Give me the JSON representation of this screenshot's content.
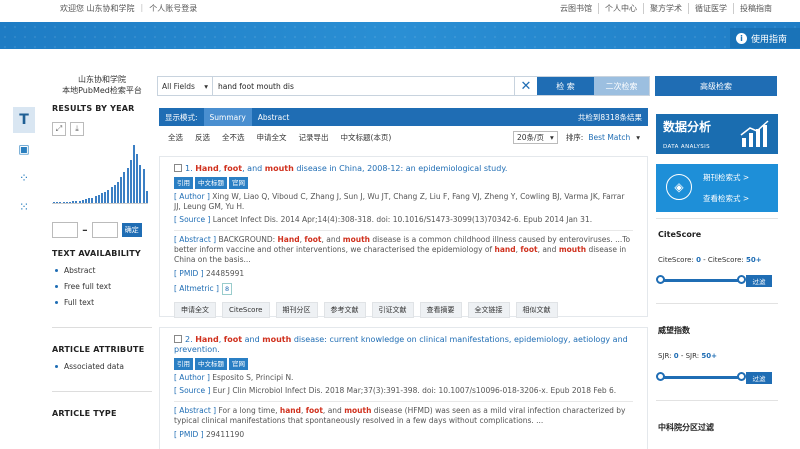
{
  "topbar": {
    "welcome": "欢迎您 山东协和学院",
    "personal_login": "个人账号登录",
    "links": [
      "云图书馆",
      "个人中心",
      "聚方学术",
      "循证医学",
      "投稿指南"
    ]
  },
  "guide_button": "使用指南",
  "org": {
    "line1": "山东协和学院",
    "line2": "本地PubMed检索平台"
  },
  "left": {
    "results_by_year": "RESULTS BY YEAR",
    "year_confirm": "确定",
    "year_sep": "-",
    "text_availability": "TEXT AVAILABILITY",
    "text_filters": [
      "Abstract",
      "Free full text",
      "Full text"
    ],
    "article_attribute": "ARTICLE ATTRIBUTE",
    "attribute_filters": [
      "Associated data"
    ],
    "article_type": "ARTICLE TYPE",
    "histogram": [
      1,
      1,
      1,
      2,
      2,
      2,
      3,
      3,
      4,
      5,
      6,
      8,
      9,
      11,
      13,
      16,
      18,
      22,
      26,
      30,
      35,
      42,
      50,
      58,
      70,
      95,
      80,
      62,
      55,
      20
    ]
  },
  "search": {
    "field": "All Fields",
    "query": "hand foot mouth dis",
    "search_btn": "检 索",
    "second_btn": "二次检索",
    "advanced_btn": "高级检索"
  },
  "display": {
    "label": "显示模式:",
    "tabs": [
      "Summary",
      "Abstract"
    ],
    "total": "共检到8318条结果"
  },
  "actions": {
    "items": [
      "全选",
      "反选",
      "全不选",
      "申请全文",
      "记录导出",
      "中文标题(本页)"
    ],
    "per_page": "20条/页",
    "sort_label": "排序:",
    "sort_value": "Best Match"
  },
  "results": [
    {
      "num": "1.",
      "title_parts": [
        [
          "hl",
          "Hand"
        ],
        [
          "t",
          ", "
        ],
        [
          "hl",
          "foot"
        ],
        [
          "t",
          ", and "
        ],
        [
          "hl",
          "mouth"
        ],
        [
          "t",
          " disease in China, 2008-12: an epidemiological study."
        ]
      ],
      "badges": [
        "引用",
        "中文标题",
        "官网"
      ],
      "author_label": "[ Author ]",
      "authors": "Xing W, Liao Q, Viboud C, Zhang J, Sun J, Wu JT, Chang Z, Liu F, Fang VJ, Zheng Y, Cowling BJ, Varma JK, Farrar JJ, Leung GM, Yu H.",
      "source_label": "[ Source ]",
      "source": "Lancet Infect Dis. 2014 Apr;14(4):308-318. doi: 10.1016/S1473-3099(13)70342-6. Epub 2014 Jan 31.",
      "abstract_label": "[ Abstract ]",
      "abstract_parts": [
        [
          "t",
          "BACKGROUND: "
        ],
        [
          "hl",
          "Hand"
        ],
        [
          "t",
          ", "
        ],
        [
          "hl",
          "foot"
        ],
        [
          "t",
          ", and "
        ],
        [
          "hl",
          "mouth"
        ],
        [
          "t",
          " disease is a common childhood illness caused by enteroviruses. ...To better inform vaccine and other interventions, we characterised the epidemiology of "
        ],
        [
          "hl",
          "hand"
        ],
        [
          "t",
          ", "
        ],
        [
          "hl",
          "foot"
        ],
        [
          "t",
          ", and "
        ],
        [
          "hl",
          "mouth"
        ],
        [
          "t",
          " disease in China on the basis..."
        ]
      ],
      "pmid_label": "[ PMID ]",
      "pmid": "24485991",
      "altmetric_label": "[ Altmetric ]",
      "altmetric": "8",
      "buttons": [
        "申请全文",
        "CiteScore",
        "期刊分区",
        "参考文献",
        "引证文献",
        "查看摘要",
        "全文链接",
        "相似文献"
      ]
    },
    {
      "num": "2.",
      "title_parts": [
        [
          "hl",
          "Hand"
        ],
        [
          "t",
          ", "
        ],
        [
          "hl",
          "foot"
        ],
        [
          "t",
          " and "
        ],
        [
          "hl",
          "mouth"
        ],
        [
          "t",
          " disease: current knowledge on clinical manifestations, epidemiology, aetiology and prevention."
        ]
      ],
      "badges": [
        "引用",
        "中文标题",
        "官网"
      ],
      "author_label": "[ Author ]",
      "authors": "Esposito S, Principi N.",
      "source_label": "[ Source ]",
      "source": "Eur J Clin Microbiol Infect Dis. 2018 Mar;37(3):391-398. doi: 10.1007/s10096-018-3206-x. Epub 2018 Feb 6.",
      "abstract_label": "[ Abstract ]",
      "abstract_parts": [
        [
          "t",
          "For a long time, "
        ],
        [
          "hl",
          "hand"
        ],
        [
          "t",
          ", "
        ],
        [
          "hl",
          "foot"
        ],
        [
          "t",
          ", and "
        ],
        [
          "hl",
          "mouth"
        ],
        [
          "t",
          " disease (HFMD) was seen as a mild viral infection characterized by typical clinical manifestations that spontaneously resolved in a few days without complications. ..."
        ]
      ],
      "pmid_label": "[ PMID ]",
      "pmid": "29411190"
    }
  ],
  "right": {
    "promo_title": "数据分析",
    "promo_sub": "DATA ANALYSIS",
    "promo2_l1": "期刊检索式 >",
    "promo2_l2": "查看检索式 >",
    "citescore_title": "CiteScore",
    "citescore_label": "CiteScore: ",
    "citescore_min": "0",
    "citescore_dash": " - CiteScore: ",
    "citescore_max": "50+",
    "sjr_title": "威望指数",
    "sjr_label": "SJR: ",
    "sjr_min": "0",
    "sjr_dash": " - SJR: ",
    "sjr_max": "50+",
    "go": "过滤",
    "cas_title": "中科院分区过滤"
  },
  "colors": {
    "primary": "#1f6db4",
    "highlight": "#d0311e",
    "banner": "#2a8fd4"
  }
}
